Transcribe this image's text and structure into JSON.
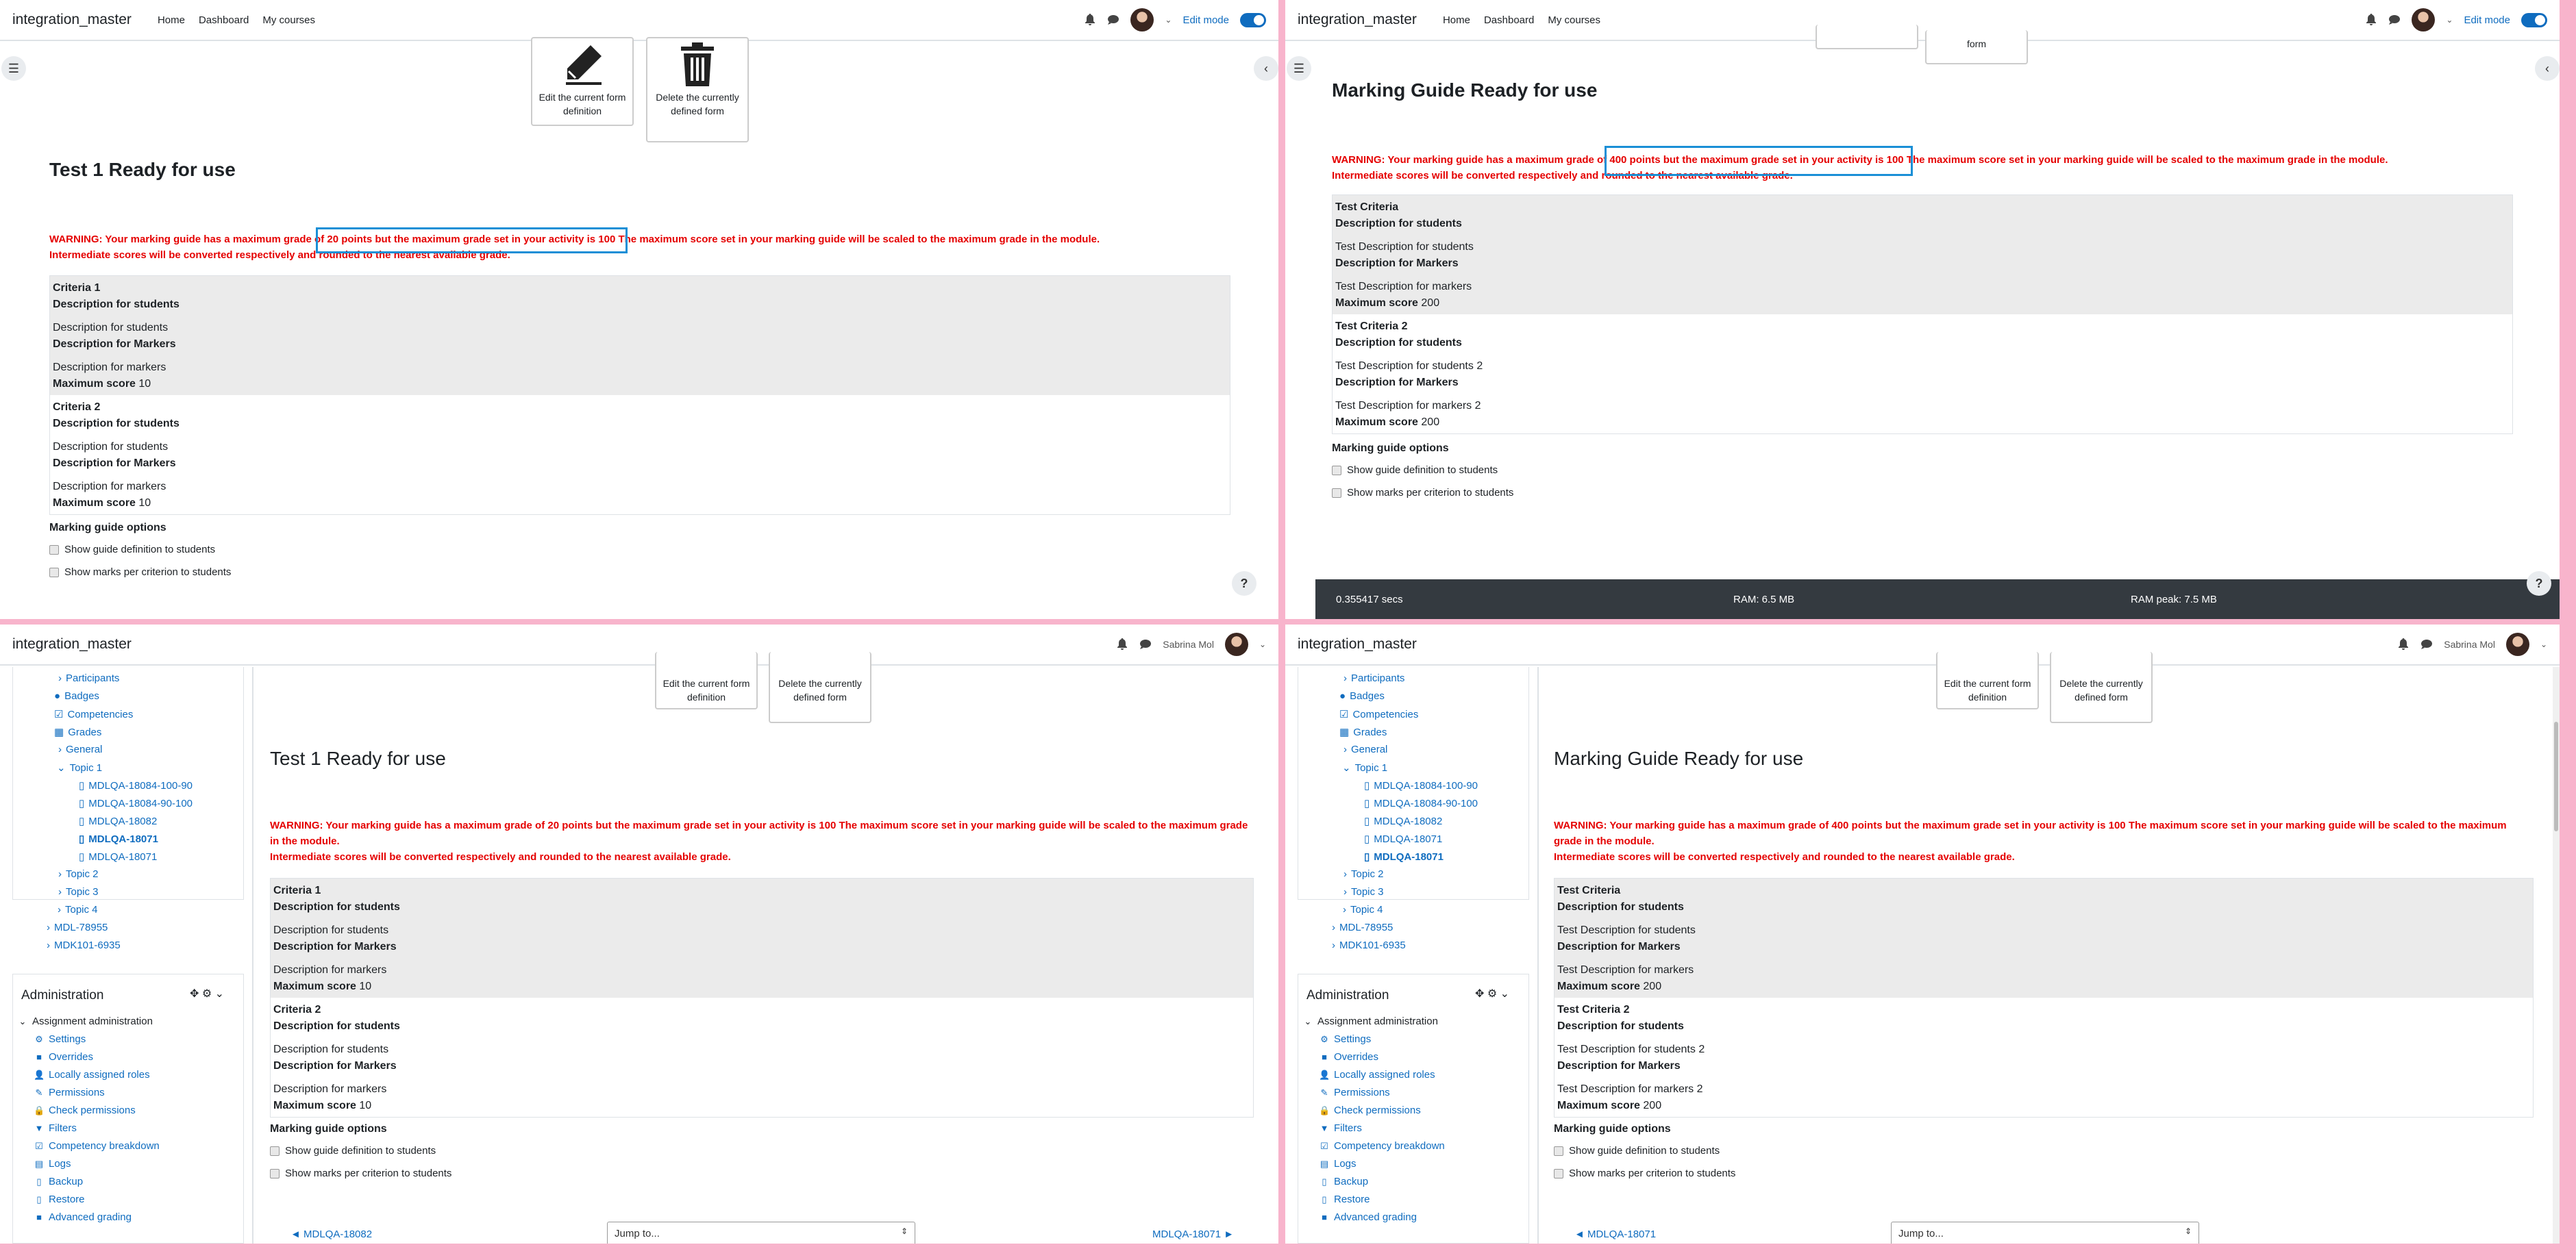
{
  "nav": {
    "brand": "integration_master",
    "home": "Home",
    "dashboard": "Dashboard",
    "mycourses": "My courses",
    "editmode": "Edit mode",
    "username": "Sabrina Mol"
  },
  "formdef": {
    "edit_label": "Edit the current form definition",
    "delete_label": "Delete the currently defined form"
  },
  "test1": {
    "title": "Test 1 Ready for use",
    "warning1": "WARNING: Your marking guide has a maximum grade of 20 points but the maximum grade set in your activity is 100 The maximum score set in your marking guide will be scaled to the maximum grade in the module.",
    "warning2": "Intermediate scores will be converted respectively and rounded to the nearest available grade.",
    "criteria": [
      {
        "name": "Criteria 1",
        "desc_students_label": "Description for students",
        "desc_students": "Description for students",
        "desc_markers_label": "Description for Markers",
        "desc_markers": "Description for markers",
        "max_label": "Maximum score",
        "max": "10"
      },
      {
        "name": "Criteria 2",
        "desc_students_label": "Description for students",
        "desc_students": "Description for students",
        "desc_markers_label": "Description for Markers",
        "desc_markers": "Description for markers",
        "max_label": "Maximum score",
        "max": "10"
      }
    ]
  },
  "guide": {
    "title": "Marking Guide Ready for use",
    "warning1": "WARNING: Your marking guide has a maximum grade of 400 points but the maximum grade set in your activity is 100 The maximum score set in your marking guide will be scaled to the maximum grade in the module.",
    "warning2": "Intermediate scores will be converted respectively and rounded to the nearest available grade.",
    "criteria": [
      {
        "name": "Test Criteria",
        "desc_students_label": "Description for students",
        "desc_students": "Test Description for students",
        "desc_markers_label": "Description for Markers",
        "desc_markers": "Test Description for markers",
        "max_label": "Maximum score",
        "max": "200"
      },
      {
        "name": "Test Criteria 2",
        "desc_students_label": "Description for students",
        "desc_students": "Test Description for students 2",
        "desc_markers_label": "Description for Markers",
        "desc_markers": "Test Description for markers 2",
        "max_label": "Maximum score",
        "max": "200"
      }
    ]
  },
  "options": {
    "title": "Marking guide options",
    "show_definition": "Show guide definition to students",
    "show_marks": "Show marks per criterion to students"
  },
  "footer": {
    "secs": "0.355417 secs",
    "ram": "RAM: 6.5 MB",
    "ram_peak": "RAM peak: 7.5 MB"
  },
  "courseindex": {
    "participants": "Participants",
    "badges": "Badges",
    "competencies": "Competencies",
    "grades": "Grades",
    "general": "General",
    "topic1": "Topic 1",
    "items": [
      "MDLQA-18084-100-90",
      "MDLQA-18084-90-100",
      "MDLQA-18082",
      "MDLQA-18071",
      "MDLQA-18071"
    ],
    "topic2": "Topic 2",
    "topic3": "Topic 3",
    "topic4": "Topic 4",
    "mdl": "MDL-78955",
    "mdk": "MDK101-6935"
  },
  "admin": {
    "title": "Administration",
    "section": "Assignment administration",
    "items": [
      "Settings",
      "Overrides",
      "Locally assigned roles",
      "Permissions",
      "Check permissions",
      "Filters",
      "Competency breakdown",
      "Logs",
      "Backup",
      "Restore",
      "Advanced grading"
    ]
  },
  "activitynav": {
    "prev3": "◄ MDLQA-18082",
    "next3": "MDLQA-18071 ►",
    "prev4": "◄ MDLQA-18071",
    "jump": "Jump to..."
  }
}
